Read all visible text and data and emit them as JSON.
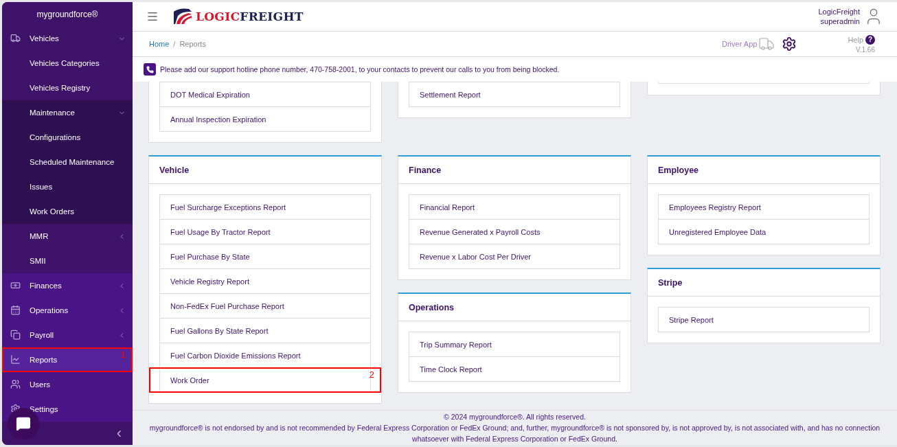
{
  "sidebar": {
    "brand": "mygroundforce®",
    "items": [
      {
        "label": "Vehicles",
        "expanded": true,
        "selected": false,
        "children": [
          {
            "label": "Vehicles Categories",
            "selected": false
          },
          {
            "label": "Vehicles Registry",
            "selected": false
          },
          {
            "label": "Maintenance",
            "expanded": true,
            "selected": false,
            "children": [
              {
                "label": "Configurations",
                "selected": false
              },
              {
                "label": "Scheduled Maintenance",
                "selected": false
              },
              {
                "label": "Issues",
                "selected": false
              },
              {
                "label": "Work Orders",
                "selected": false
              }
            ]
          },
          {
            "label": "MMR",
            "expanded": false,
            "selected": false
          },
          {
            "label": "SMII",
            "selected": false
          }
        ]
      },
      {
        "label": "Finances",
        "expanded": false,
        "selected": false
      },
      {
        "label": "Operations",
        "expanded": false,
        "selected": false
      },
      {
        "label": "Payroll",
        "expanded": false,
        "selected": false
      },
      {
        "label": "Reports",
        "selected": true,
        "annotation": "1"
      },
      {
        "label": "Users",
        "selected": false
      },
      {
        "label": "Settings",
        "selected": false
      }
    ],
    "collapse": "‹"
  },
  "header": {
    "logo": {
      "part_1": "LOGIC",
      "part_2": "FREIGHT"
    },
    "user": {
      "name": "LogicFreight",
      "role": "superadmin"
    }
  },
  "breadcrumb": {
    "items": [
      "Home",
      "Reports"
    ],
    "separator": "/"
  },
  "toolbar": {
    "driver_app": "Driver App",
    "help": "Help",
    "help_icon": "?",
    "version": "V.1.66"
  },
  "notice": "Please add our support hotline phone number, 470-758-2001, to your contacts to prevent our calls to you from being blocked.",
  "report_columns": [
    [
      {
        "clipped": true,
        "items": [
          {
            "label": "DOT Medical Expiration"
          },
          {
            "label": "Annual Inspection Expiration"
          }
        ]
      },
      {
        "clipped": false,
        "title": "Vehicle",
        "items": [
          {
            "label": "Fuel Surcharge Exceptions Report"
          },
          {
            "label": "Fuel Usage By Tractor Report"
          },
          {
            "label": "Fuel Purchase By State"
          },
          {
            "label": "Vehicle Registry Report"
          },
          {
            "label": "Non-FedEx Fuel Purchase Report"
          },
          {
            "label": "Fuel Gallons By State Report"
          },
          {
            "label": "Fuel Carbon Dioxide Emissions Report"
          },
          {
            "label": "Work Order",
            "annotation": "2"
          }
        ]
      }
    ],
    [
      {
        "clipped": true,
        "items": [
          {
            "label": "Settlement Report"
          }
        ]
      },
      {
        "clipped": false,
        "title": "Finance",
        "items": [
          {
            "label": "Financial Report"
          },
          {
            "label": "Revenue Generated x Payroll Costs"
          },
          {
            "label": "Revenue x Labor Cost Per Driver"
          }
        ]
      },
      {
        "clipped": false,
        "title": "Operations",
        "items": [
          {
            "label": "Trip Summary Report"
          },
          {
            "label": "Time Clock Report"
          }
        ]
      }
    ],
    [
      {
        "clipped": true
      },
      {
        "clipped": false,
        "title": "Employee",
        "items": [
          {
            "label": "Employees Registry Report"
          },
          {
            "label": "Unregistered Employee Data"
          }
        ]
      },
      {
        "clipped": false,
        "title": "Stripe",
        "items": [
          {
            "label": "Stripe Report"
          }
        ]
      }
    ]
  ],
  "footer": {
    "copyright": "© 2024 mygroundforce®. All rights reserved.",
    "disclaimer": "mygroundforce® is not endorsed by and is not recommended by Federal Express Corporation or FedEx Ground; and, further, mygroundforce® is not sponsored by, is not approved by, is not associated with, and has no connection whatsoever with Federal Express Corporation or FedEx Ground."
  }
}
